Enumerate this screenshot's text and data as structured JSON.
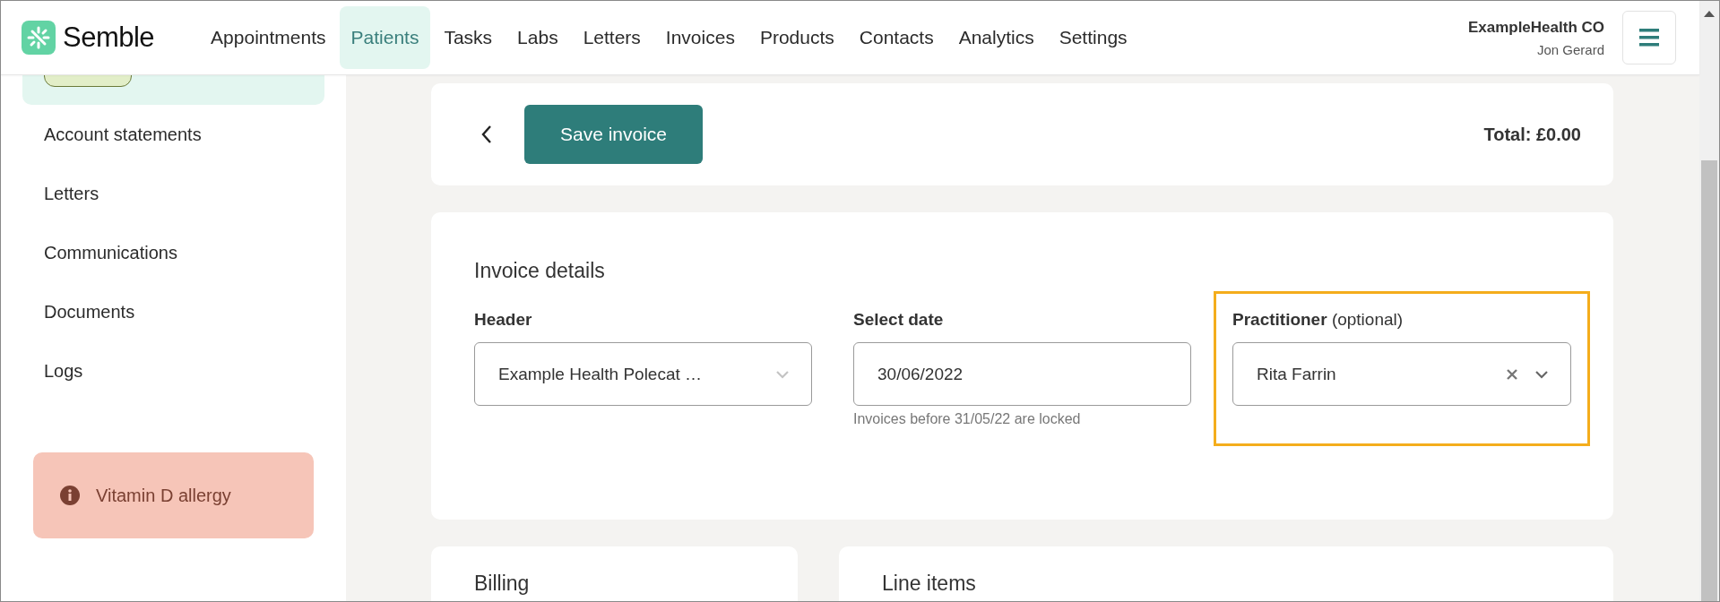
{
  "app": {
    "logo": "Semble"
  },
  "nav": [
    {
      "label": "Appointments",
      "selected": false
    },
    {
      "label": "Patients",
      "selected": true
    },
    {
      "label": "Tasks",
      "selected": false
    },
    {
      "label": "Labs",
      "selected": false
    },
    {
      "label": "Letters",
      "selected": false
    },
    {
      "label": "Invoices",
      "selected": false
    },
    {
      "label": "Products",
      "selected": false
    },
    {
      "label": "Contacts",
      "selected": false
    },
    {
      "label": "Analytics",
      "selected": false
    },
    {
      "label": "Settings",
      "selected": false
    }
  ],
  "account": {
    "organisation": "ExampleHealth CO",
    "user": "Jon Gerard"
  },
  "sidebar": {
    "items": [
      {
        "selected": true
      },
      {
        "label": "Account statements",
        "selected": false
      },
      {
        "label": "Letters",
        "selected": false
      },
      {
        "label": "Communications",
        "selected": false
      },
      {
        "label": "Documents",
        "selected": false
      },
      {
        "label": "Logs",
        "selected": false
      }
    ],
    "alert": {
      "text": "Vitamin D allergy"
    }
  },
  "toolbar": {
    "save_button": "Save invoice",
    "total": "Total: £0.00"
  },
  "invoice_details": {
    "title": "Invoice details",
    "fields": [
      {
        "kind": "select",
        "label": "Header",
        "value": "Example Health Polecat …",
        "clearable": false,
        "focused": false
      },
      {
        "kind": "date",
        "label": "Select date",
        "value": "30/06/2022",
        "hint": "Invoices before 31/05/22 are locked"
      },
      {
        "kind": "select",
        "label": "Practitioner",
        "optional": "(optional)",
        "value": "Rita Farrin",
        "clearable": true,
        "focused": true
      }
    ]
  },
  "cards": [
    {
      "title": "Billing"
    },
    {
      "title": "Line items"
    }
  ]
}
